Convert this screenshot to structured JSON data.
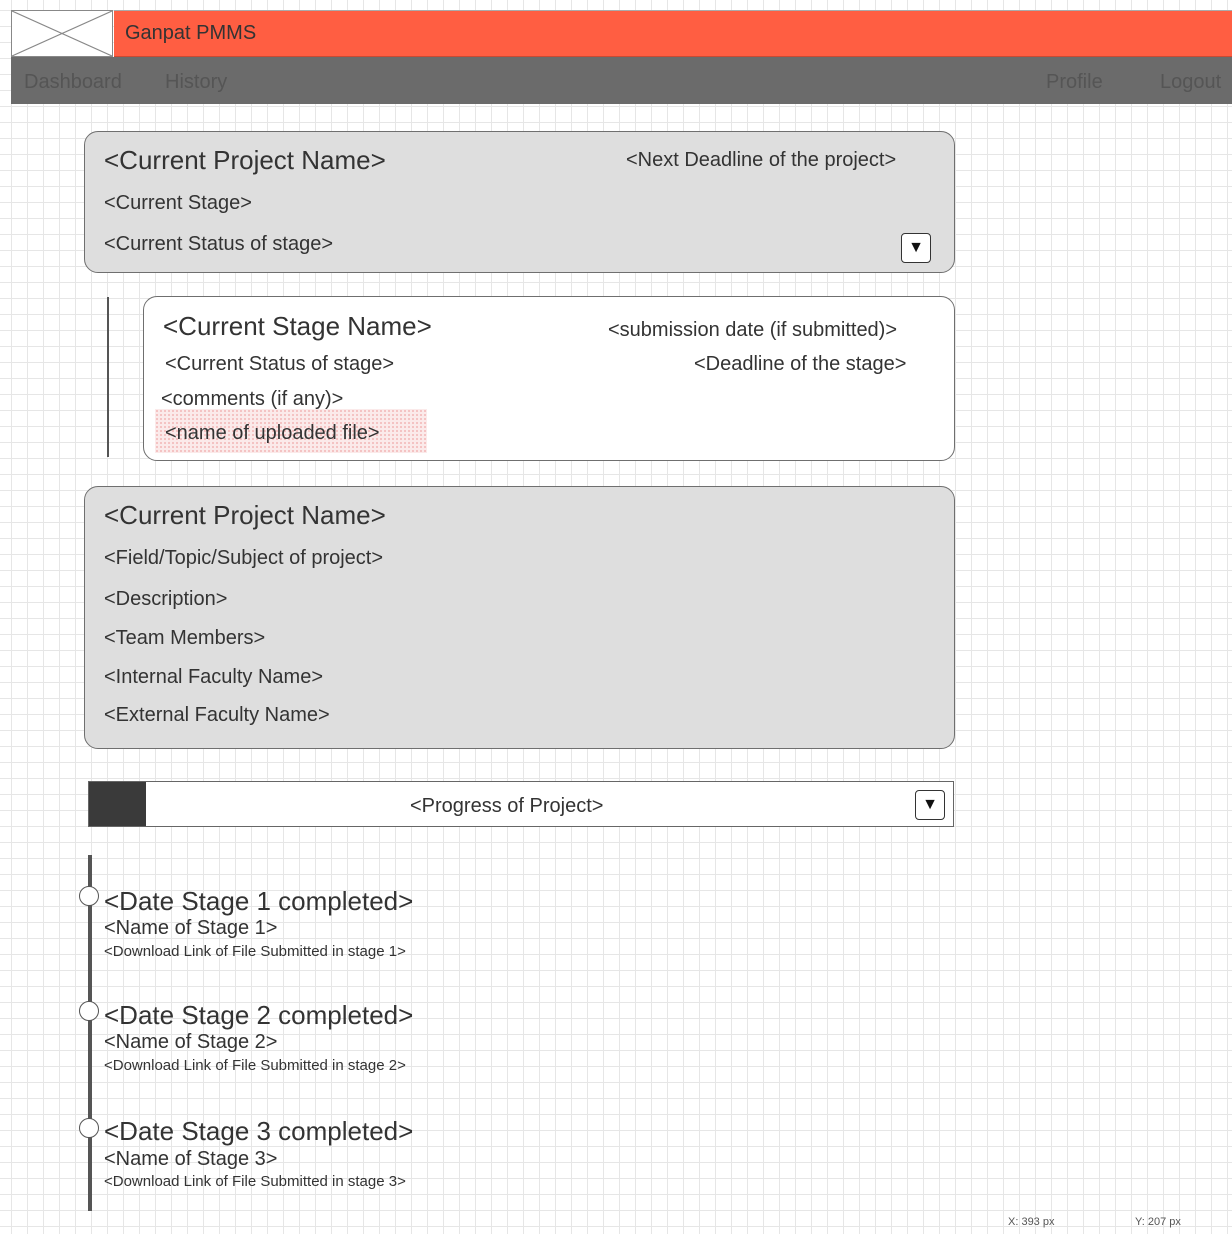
{
  "app": {
    "title": "Ganpat PMMS"
  },
  "nav": {
    "left": [
      "Dashboard",
      "History"
    ],
    "right": [
      "Profile",
      "Logout"
    ]
  },
  "project_summary": {
    "name": "<Current Project Name>",
    "next_deadline": "<Next Deadline of the project>",
    "stage": "<Current Stage>",
    "status": "<Current Status of stage>",
    "expand_glyph": "▼"
  },
  "stage_detail": {
    "name": "<Current Stage Name>",
    "submission_date": "<submission date (if submitted)>",
    "status": "<Current Status of stage>",
    "deadline": "<Deadline of the stage>",
    "comments": "<comments (if any)>",
    "uploaded_file": "<name of uploaded file>"
  },
  "project_info": {
    "name": "<Current Project Name>",
    "field": "<Field/Topic/Subject of project>",
    "description": "<Description>",
    "team": "<Team Members>",
    "internal_faculty": "<Internal Faculty Name>",
    "external_faculty": "<External Faculty Name>"
  },
  "progress": {
    "label": "<Progress of Project>",
    "fraction": 0.066,
    "expand_glyph": "▼",
    "fill_color": "#3a3a3a"
  },
  "timeline": [
    {
      "date": "<Date Stage 1 completed>",
      "name": "<Name of Stage 1>",
      "link": "<Download Link of File Submitted in stage 1>"
    },
    {
      "date": "<Date Stage 2 completed>",
      "name": "<Name of Stage 2>",
      "link": "<Download Link of File Submitted in stage 2>"
    },
    {
      "date": "<Date Stage 3 completed>",
      "name": "<Name of Stage 3>",
      "link": "<Download Link of File Submitted in stage 3>"
    }
  ],
  "status_bar": {
    "x": "X: 393 px",
    "y": "Y: 207 px"
  },
  "colors": {
    "header": "#ff5e42",
    "nav": "#6b6b6b",
    "card": "#dedede",
    "accent_text": "#333333"
  },
  "icons": {
    "logo": "image-placeholder-icon",
    "dropdown": "chevron-down-icon",
    "timeline_node": "circle-node-icon"
  }
}
